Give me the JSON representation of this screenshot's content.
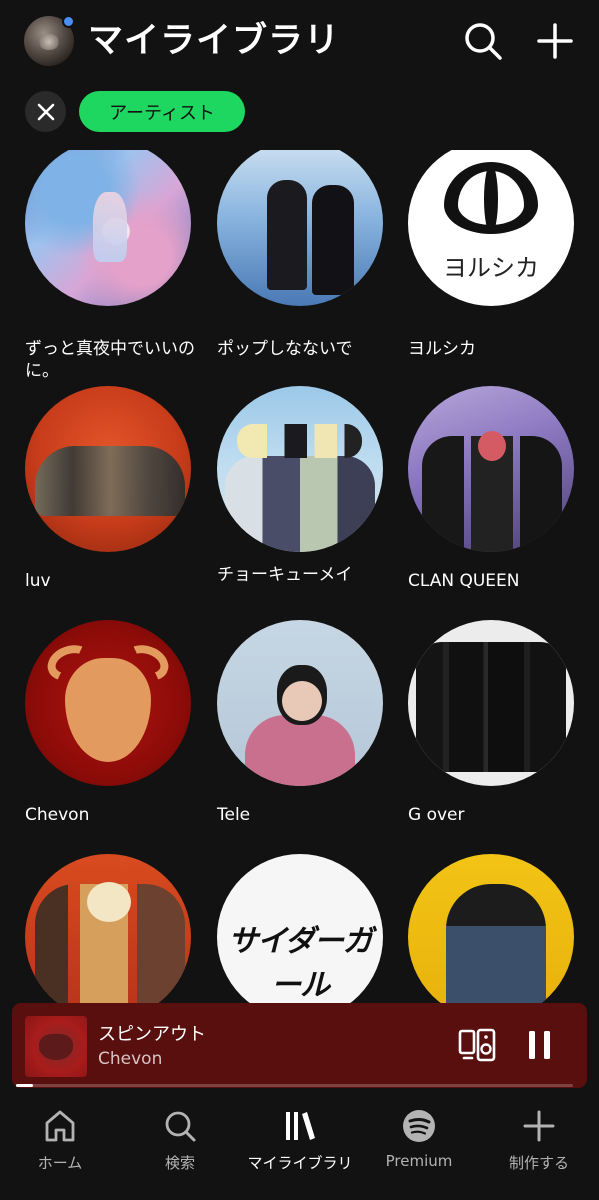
{
  "header": {
    "title": "マイライブラリ",
    "filter_chip": "アーティスト"
  },
  "artists": [
    {
      "name": "ずっと真夜中でいいのに。"
    },
    {
      "name": "ポップしなないで"
    },
    {
      "name": "ヨルシカ",
      "art_text": "ヨルシカ"
    },
    {
      "name": "luv"
    },
    {
      "name": "チョーキューメイ"
    },
    {
      "name": "CLAN QUEEN"
    },
    {
      "name": "Chevon"
    },
    {
      "name": "Tele"
    },
    {
      "name": "G over"
    },
    {
      "name": ""
    },
    {
      "name": "",
      "art_text": "サイダーガール"
    },
    {
      "name": ""
    }
  ],
  "now_playing": {
    "title": "スピンアウト",
    "artist": "Chevon",
    "progress": 0.03
  },
  "nav": {
    "home": "ホーム",
    "search": "検索",
    "library": "マイライブラリ",
    "premium": "Premium",
    "create": "制作する"
  },
  "colors": {
    "accent": "#1ed760",
    "background": "#121212",
    "now_playing_bg": "#5a0f0f"
  }
}
